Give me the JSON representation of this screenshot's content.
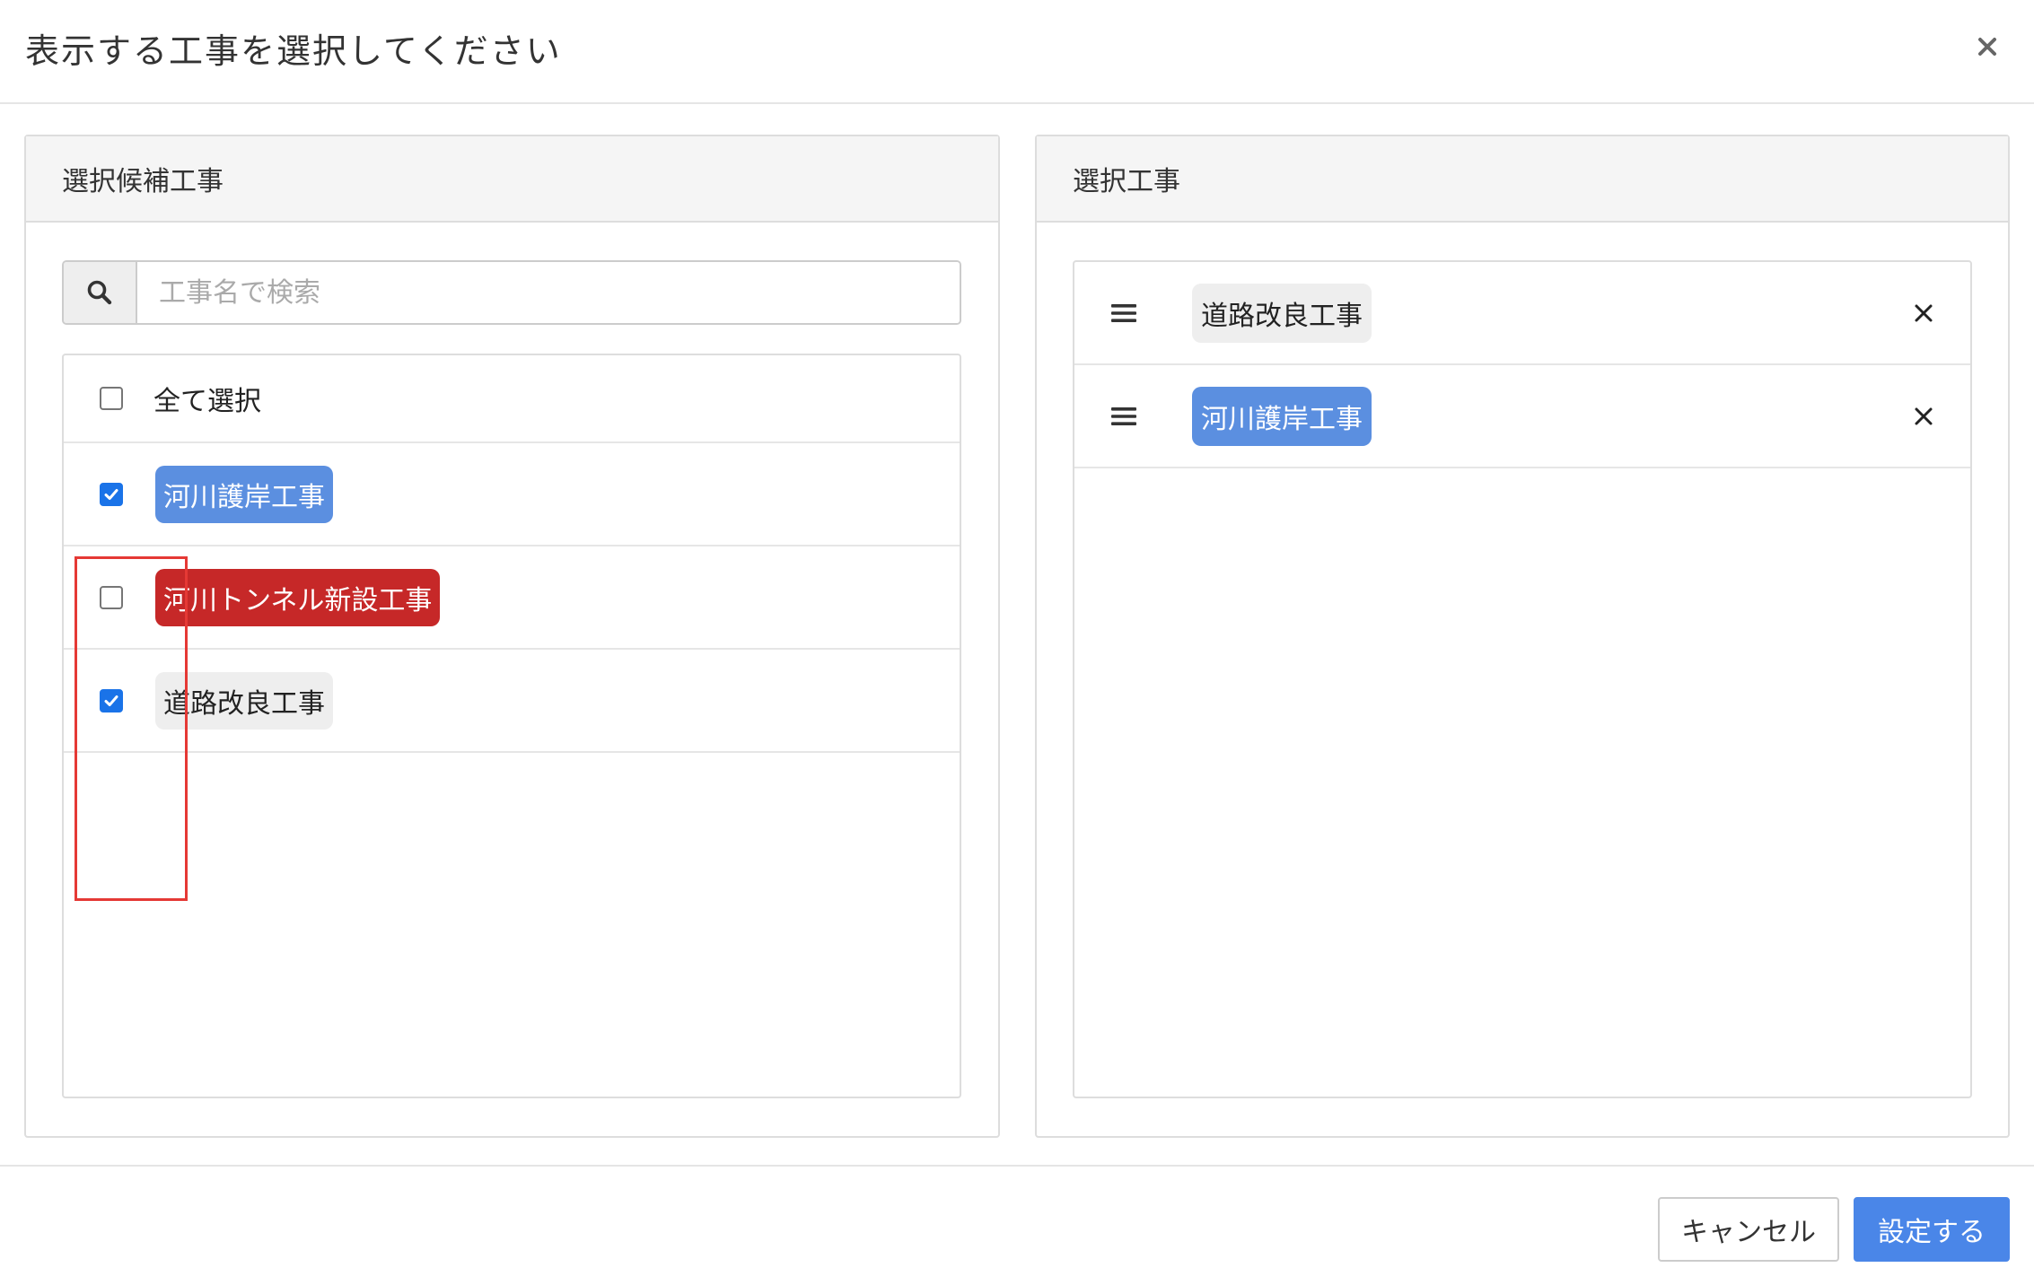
{
  "dialog": {
    "title": "表示する工事を選択してください",
    "close_label": "×"
  },
  "candidates": {
    "heading": "選択候補工事",
    "search": {
      "placeholder": "工事名で検索",
      "value": ""
    },
    "select_all": {
      "label": "全て選択",
      "checked": false
    },
    "items": [
      {
        "label": "河川護岸工事",
        "checked": true,
        "tag_color": "#5b8fe0"
      },
      {
        "label": "河川トンネル新設工事",
        "checked": false,
        "tag_color": "#c62828"
      },
      {
        "label": "道路改良工事",
        "checked": true,
        "tag_color": "#eeeeee"
      }
    ]
  },
  "selected": {
    "heading": "選択工事",
    "items": [
      {
        "label": "道路改良工事",
        "tag_color": "#eeeeee"
      },
      {
        "label": "河川護岸工事",
        "tag_color": "#5b8fe0"
      }
    ]
  },
  "footer": {
    "cancel_label": "キャンセル",
    "submit_label": "設定する"
  },
  "colors": {
    "primary": "#4a86e8",
    "highlight": "#e53935"
  },
  "icons": {
    "search": "search-icon",
    "drag": "drag-handle-icon",
    "remove": "remove-icon",
    "close": "close-icon"
  }
}
